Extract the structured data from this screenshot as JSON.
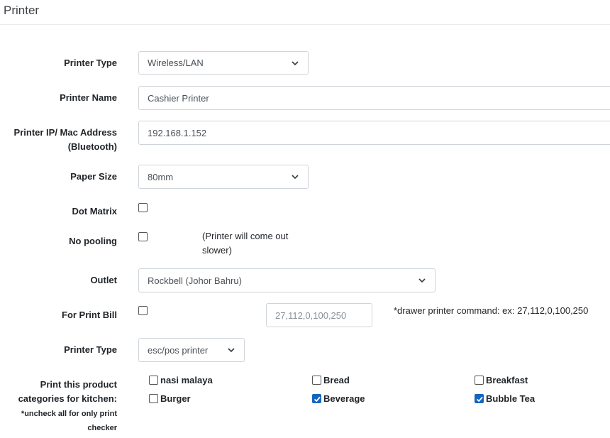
{
  "header": {
    "title": "Printer"
  },
  "form": {
    "printer_type": {
      "label": "Printer Type",
      "value": "Wireless/LAN"
    },
    "printer_name": {
      "label": "Printer Name",
      "value": "Cashier Printer"
    },
    "printer_ip": {
      "label_line1": "Printer IP/ Mac Address",
      "label_line2": "(Bluetooth)",
      "value": "192.168.1.152"
    },
    "paper_size": {
      "label": "Paper Size",
      "value": "80mm"
    },
    "dot_matrix": {
      "label": "Dot Matrix",
      "checked": false
    },
    "no_pooling": {
      "label": "No pooling",
      "checked": false,
      "note_line1": "(Printer will come out",
      "note_line2": "slower)"
    },
    "outlet": {
      "label": "Outlet",
      "value": "Rockbell (Johor Bahru)"
    },
    "for_print_bill": {
      "label": "For Print Bill",
      "checked": false,
      "command_placeholder": "27,112,0,100,250",
      "hint": "*drawer printer command: ex: 27,112,0,100,250"
    },
    "printer_type_2": {
      "label": "Printer Type",
      "value": "esc/pos printer"
    },
    "categories": {
      "label_line1": "Print this product",
      "label_line2": "categories for kitchen:",
      "note_line1": "*uncheck all for only print",
      "note_line2": "checker",
      "items": [
        {
          "name": "nasi malaya",
          "checked": false
        },
        {
          "name": "Bread",
          "checked": false
        },
        {
          "name": "Breakfast",
          "checked": false
        },
        {
          "name": "Burger",
          "checked": false
        },
        {
          "name": "Beverage",
          "checked": true
        },
        {
          "name": "Bubble Tea",
          "checked": true
        }
      ]
    }
  },
  "icons": {
    "select_arrow": "chevron-down-icon",
    "check": "checkmark-icon"
  },
  "colors": {
    "checked_bg": "#1565c0",
    "border": "#ced4da"
  }
}
